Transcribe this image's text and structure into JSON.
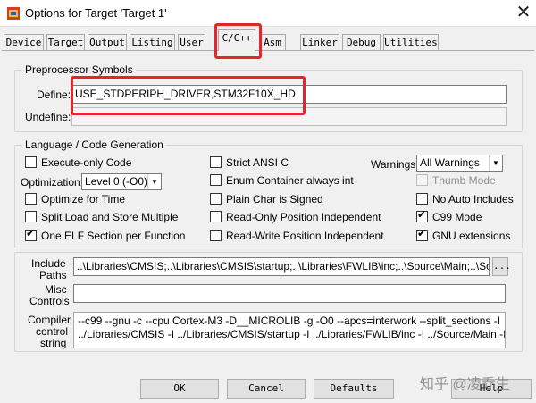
{
  "window": {
    "title": "Options for Target 'Target 1'",
    "close_glyph": "✕"
  },
  "tabs": [
    "Device",
    "Target",
    "Output",
    "Listing",
    "User",
    "C/C++",
    "Asm",
    "Linker",
    "Debug",
    "Utilities"
  ],
  "active_tab": "C/C++",
  "preprocessor": {
    "legend": "Preprocessor Symbols",
    "define_label": "Define:",
    "define_value": "USE_STDPERIPH_DRIVER,STM32F10X_HD",
    "undefine_label": "Undefine:",
    "undefine_value": ""
  },
  "codegen": {
    "legend": "Language / Code Generation",
    "execute_only": {
      "label": "Execute-only Code",
      "checked": false
    },
    "optimization_label": "Optimization:",
    "optimization_value": "Level 0 (-O0)",
    "optimize_time": {
      "label": "Optimize for Time",
      "checked": false
    },
    "split_load": {
      "label": "Split Load and Store Multiple",
      "checked": false
    },
    "one_elf": {
      "label": "One ELF Section per Function",
      "checked": true
    },
    "strict_ansi": {
      "label": "Strict ANSI C",
      "checked": false
    },
    "enum_int": {
      "label": "Enum Container always int",
      "checked": false
    },
    "plain_char": {
      "label": "Plain Char is Signed",
      "checked": false
    },
    "ro_pi": {
      "label": "Read-Only Position Independent",
      "checked": false
    },
    "rw_pi": {
      "label": "Read-Write Position Independent",
      "checked": false
    },
    "warnings_label": "Warnings:",
    "warnings_value": "All Warnings",
    "thumb_mode": {
      "label": "Thumb Mode",
      "checked": false,
      "disabled": true
    },
    "no_auto_includes": {
      "label": "No Auto Includes",
      "checked": false
    },
    "c99_mode": {
      "label": "C99 Mode",
      "checked": true
    },
    "gnu_ext": {
      "label": "GNU extensions",
      "checked": true
    }
  },
  "include": {
    "label_line1": "Include",
    "label_line2": "Paths",
    "value": "..\\Libraries\\CMSIS;..\\Libraries\\CMSIS\\startup;..\\Libraries\\FWLIB\\inc;..\\Source\\Main;..\\Source\\Devi",
    "browse_label": "..."
  },
  "misc": {
    "label_line1": "Misc",
    "label_line2": "Controls",
    "value": ""
  },
  "compiler": {
    "label_line1": "Compiler",
    "label_line2": "control",
    "label_line3": "string",
    "line1": "--c99 --gnu -c --cpu Cortex-M3 -D__MICROLIB -g -O0 --apcs=interwork --split_sections -I",
    "line2": "../Libraries/CMSIS -I ../Libraries/CMSIS/startup -I ../Libraries/FWLIB/inc -I ../Source/Main -I"
  },
  "buttons": {
    "ok": "OK",
    "cancel": "Cancel",
    "defaults": "Defaults",
    "help": "Help"
  },
  "watermark": "知乎 @凌乔生",
  "colors": {
    "highlight": "#e3262d"
  }
}
